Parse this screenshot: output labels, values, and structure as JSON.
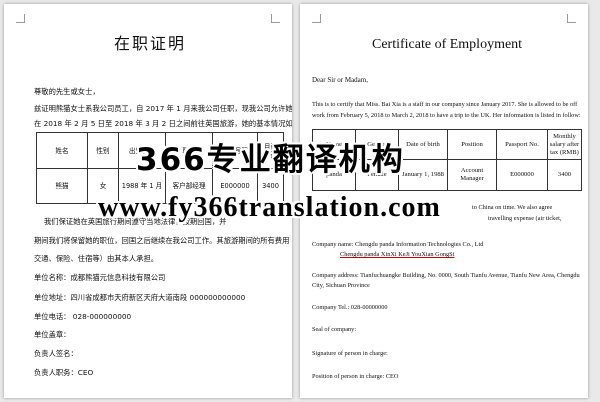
{
  "left_page": {
    "title": "在职证明",
    "salutation": "尊敬的先生或女士，",
    "para1_line1": "兹证明熊猫女士系我公司员工，自 2017 年 1 月来我公司任职，现我公司允许她",
    "para1_line2": "在 2018 年 2 月 5 日至 2018 年 3 月 2 日之间前往英国旅游，她的基本情况如下：",
    "table_headers": [
      "姓名",
      "性别",
      "出生日期",
      "职务",
      "护照号码",
      "月薪（元）"
    ],
    "table_row": [
      "熊猫",
      "女",
      "1988 年 1 月",
      "客户部经理",
      "E000000",
      "3400"
    ],
    "para2_line1": "我们保证她在英国旅行期间遵守当地法律，按期回国，并",
    "para2_line2": "期间我们将保留她的职位，回国之后继续在我公司工作。其旅游期间的所有费用（机票、",
    "para2_line3": "交通、保险、住宿等）由其本人承担。",
    "company": "单位名称：成都熊猫元信息科技有限公司",
    "address": "单位地址：四川省成都市天府新区天府大道南段 000000000000",
    "phone": "单位电话： 028-000000000",
    "seal": "单位盖章：",
    "person_sign": "负责人签名：",
    "person_title": "负责人职务：CEO"
  },
  "right_page": {
    "title": "Certificate of Employment",
    "salutation": "Dear Sir or Madam,",
    "para1_line1": "This is to certify that Miss. Bai Xia is a staff in our company since January 2017. She is allowed to be off",
    "para1_line2": "work from February 5, 2018 to March 2, 2018 to have a trip to the UK. Her information is listed in follow:",
    "table_headers": [
      "Name",
      "Gender",
      "Date of birth",
      "Position",
      "Passport No.",
      "Monthly salary after tax (RMB)"
    ],
    "table_row": [
      "panda",
      "Female",
      "January 1, 1988",
      "Account Manager",
      "E000000",
      "3400"
    ],
    "para2_line1": "to China on time. We also agree",
    "para2_line2": "travelling expense (air ticket,",
    "company_line1": "Company name: Chengdu panda Information Technologies Co., Ltd",
    "company_line2": "Chengdu panda XinXi KeJi YouXian GongSi",
    "address_line1": "Company address: Tianfuchuangke Building, No. 0000, South Tianfu Avenue, Tianfu New Area, Chengdu",
    "address_line2": "City, Sichuan Province",
    "tel": "Company Tel.: 028-00000000",
    "seal": "Seal of company:",
    "signature": "Signature of person in charge:",
    "position": "Position of person in charge: CEO"
  },
  "watermark": {
    "line1": "366专业翻译机构",
    "line2": "www.fy366translation.com"
  }
}
